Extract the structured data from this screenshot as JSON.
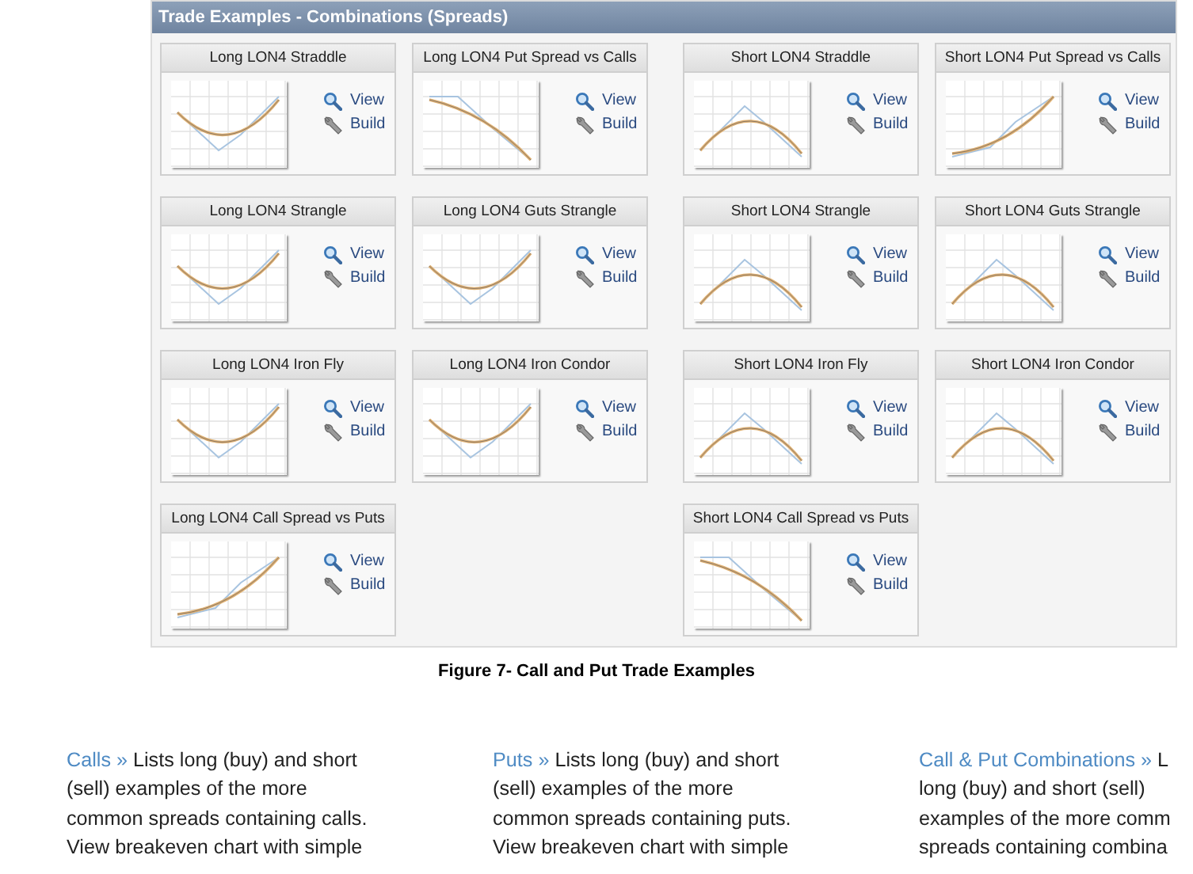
{
  "panel": {
    "title": "Trade Examples - Combinations (Spreads)",
    "groups": [
      {
        "cards": [
          {
            "title": "Long LON4 Straddle",
            "kind": "valley",
            "links": [
              "View",
              "Build"
            ]
          },
          {
            "title": "Long LON4 Put Spread vs Calls",
            "kind": "falling",
            "links": [
              "View",
              "Build"
            ]
          },
          {
            "title": "Long LON4 Strangle",
            "kind": "valley",
            "links": [
              "View",
              "Build"
            ]
          },
          {
            "title": "Long LON4 Guts Strangle",
            "kind": "valley",
            "links": [
              "View",
              "Build"
            ]
          },
          {
            "title": "Long LON4 Iron Fly",
            "kind": "valley",
            "links": [
              "View",
              "Build"
            ]
          },
          {
            "title": "Long LON4 Iron Condor",
            "kind": "valley",
            "links": [
              "View",
              "Build"
            ]
          },
          {
            "title": "Long LON4 Call Spread vs Puts",
            "kind": "rising",
            "links": [
              "View",
              "Build"
            ]
          }
        ]
      },
      {
        "cards": [
          {
            "title": "Short LON4 Straddle",
            "kind": "peak",
            "links": [
              "View",
              "Build"
            ]
          },
          {
            "title": "Short LON4 Put Spread vs Calls",
            "kind": "rising",
            "links": [
              "View",
              "Build"
            ]
          },
          {
            "title": "Short LON4 Strangle",
            "kind": "peak",
            "links": [
              "View",
              "Build"
            ]
          },
          {
            "title": "Short LON4 Guts Strangle",
            "kind": "peak",
            "links": [
              "View",
              "Build"
            ]
          },
          {
            "title": "Short LON4 Iron Fly",
            "kind": "peak",
            "links": [
              "View",
              "Build"
            ]
          },
          {
            "title": "Short LON4 Iron Condor",
            "kind": "peak",
            "links": [
              "View",
              "Build"
            ]
          },
          {
            "title": "Short LON4 Call Spread vs Puts",
            "kind": "falling",
            "links": [
              "View",
              "Build"
            ]
          }
        ]
      }
    ]
  },
  "caption": "Figure 7- Call and Put Trade Examples",
  "columns": [
    {
      "heading": "Calls »",
      "lines": [
        "Lists long (buy) and short",
        "(sell) examples of the more",
        "common spreads containing calls.",
        "View breakeven chart with simple"
      ]
    },
    {
      "heading": "Puts »",
      "lines": [
        "Lists long (buy) and short",
        "(sell) examples of the more",
        "common spreads containing puts.",
        "View breakeven chart with simple"
      ]
    },
    {
      "heading": "Call & Put Combinations »",
      "lines": [
        "L",
        "long (buy) and short (sell)",
        "examples of the more comm",
        "spreads containing combina"
      ]
    }
  ]
}
